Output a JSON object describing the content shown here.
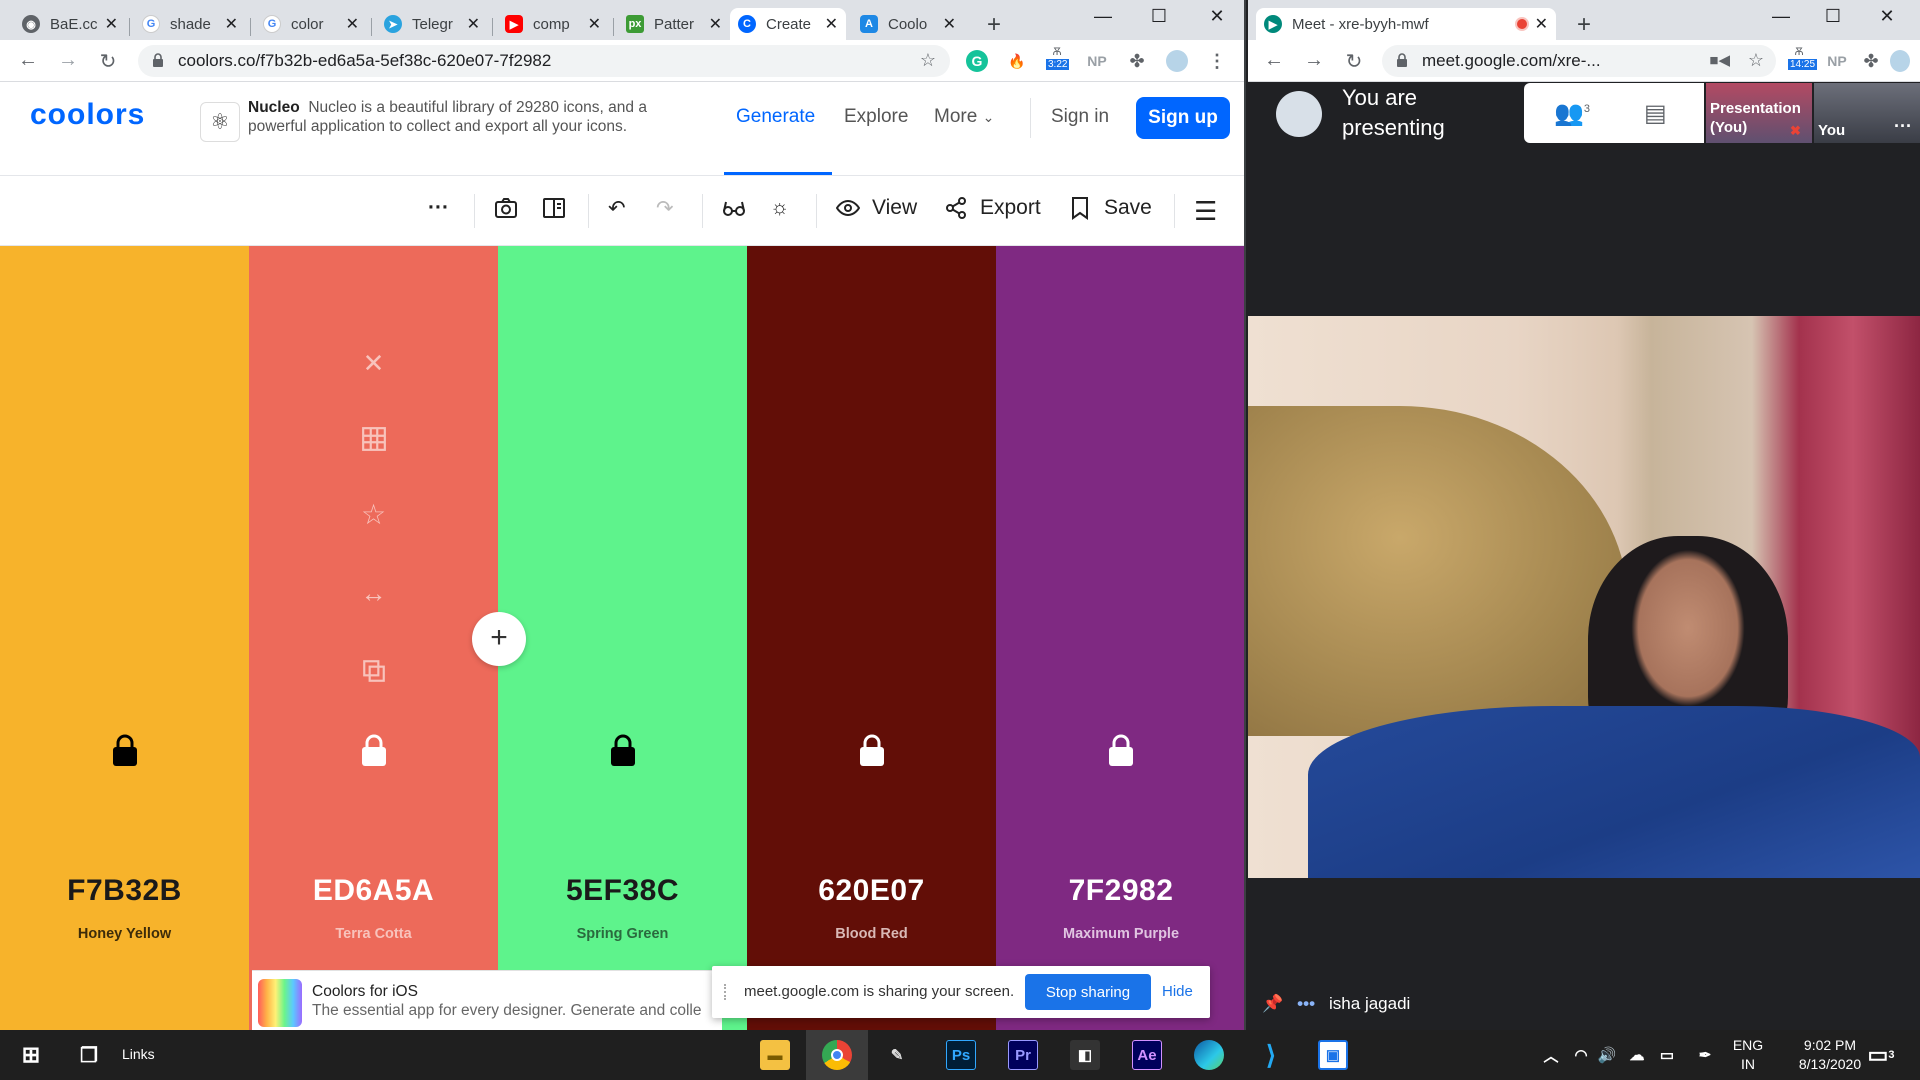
{
  "left_browser": {
    "tabs": [
      {
        "title": "BaE.cc",
        "favicon": "globe-icon",
        "color": "#5f6368"
      },
      {
        "title": "shade",
        "favicon": "google-icon",
        "color": "#4285f4"
      },
      {
        "title": "color",
        "favicon": "google-icon",
        "color": "#4285f4"
      },
      {
        "title": "Telegr",
        "favicon": "telegram-icon",
        "color": "#2aa3df"
      },
      {
        "title": "comp",
        "favicon": "youtube-icon",
        "color": "#ff0000"
      },
      {
        "title": "Patter",
        "favicon": "px-icon",
        "color": "#3d9b35"
      },
      {
        "title": "Create",
        "favicon": "coolors-icon",
        "color": "#0066ff"
      },
      {
        "title": "Coolo",
        "favicon": "appstore-icon",
        "color": "#1e88e5"
      }
    ],
    "url": "coolors.co/f7b32b-ed6a5a-5ef38c-620e07-7f2982",
    "ext_badge": "3:22",
    "ext_np": "NP"
  },
  "coolors": {
    "logo": "coolors",
    "ad": {
      "brand": "Nucleo",
      "text": "Nucleo is a beautiful library of 29280 icons, and a powerful application to collect and export all your icons."
    },
    "nav": {
      "generate": "Generate",
      "explore": "Explore",
      "more": "More",
      "sign_in": "Sign in",
      "sign_up": "Sign up"
    },
    "toolbar": {
      "view": "View",
      "export": "Export",
      "save": "Save"
    },
    "swatches": [
      {
        "hex": "F7B32B",
        "name": "Honey Yellow",
        "bg": "#f7b32b",
        "fg": "#1a1a1a",
        "sub": "#3d2c0a",
        "lock": "#000000"
      },
      {
        "hex": "ED6A5A",
        "name": "Terra Cotta",
        "bg": "#ed6a5a",
        "fg": "#ffffff",
        "sub": "#f8c3bc",
        "lock": "#ffffff"
      },
      {
        "hex": "5EF38C",
        "name": "Spring Green",
        "bg": "#5ef38c",
        "fg": "#1a1a1a",
        "sub": "#2a6a3e",
        "lock": "#000000"
      },
      {
        "hex": "620E07",
        "name": "Blood Red",
        "bg": "#620e07",
        "fg": "#ffffff",
        "sub": "#d9b8b5",
        "lock": "#ffffff"
      },
      {
        "hex": "7F2982",
        "name": "Maximum Purple",
        "bg": "#7f2982",
        "fg": "#ffffff",
        "sub": "#e0c4e1",
        "lock": "#ffffff"
      }
    ],
    "ios_banner": {
      "title": "Coolors for iOS",
      "subtitle": "The essential app for every designer. Generate and colle"
    }
  },
  "share_bar": {
    "text": "meet.google.com is sharing your screen.",
    "stop": "Stop sharing",
    "hide": "Hide"
  },
  "right_browser": {
    "tab_title": "Meet - xre-byyh-mwf",
    "url": "meet.google.com/xre-...",
    "ext_badge": "14:25",
    "ext_np": "NP"
  },
  "meet": {
    "presenting": "You are presenting",
    "people_count": "3",
    "thumb_presentation": "Presentation (You)",
    "thumb_you": "You",
    "participant_name": "isha jagadi"
  },
  "taskbar": {
    "links": "Links",
    "lang_top": "ENG",
    "lang_bottom": "IN",
    "time": "9:02 PM",
    "date": "8/13/2020",
    "notif_count": "3"
  }
}
